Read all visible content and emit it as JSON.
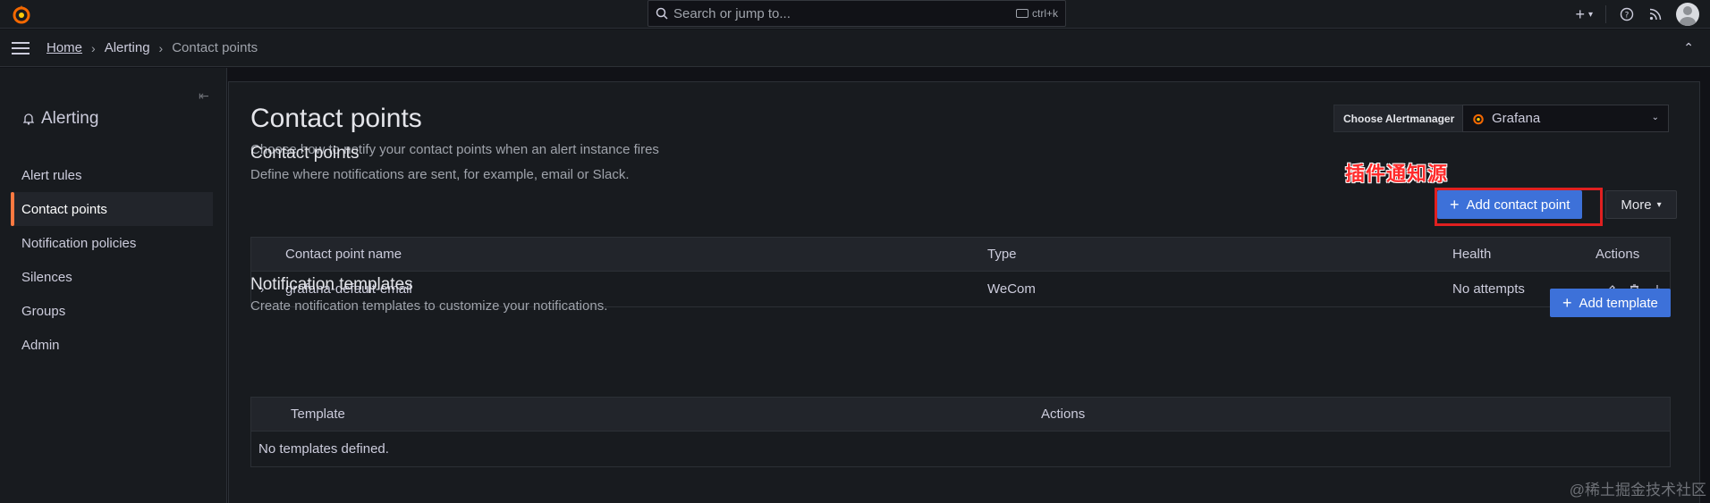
{
  "topbar": {
    "search_placeholder": "Search or jump to...",
    "search_shortcut": "ctrl+k",
    "icons": [
      "grafana-logo-icon",
      "search-icon",
      "keyboard-icon",
      "plus-icon",
      "help-icon",
      "rss-icon",
      "user-avatar"
    ]
  },
  "breadcrumb": {
    "home": "Home",
    "section": "Alerting",
    "current": "Contact points"
  },
  "sidebar": {
    "title": "Alerting",
    "items": [
      {
        "label": "Alert rules",
        "active": false
      },
      {
        "label": "Contact points",
        "active": true
      },
      {
        "label": "Notification policies",
        "active": false
      },
      {
        "label": "Silences",
        "active": false
      },
      {
        "label": "Groups",
        "active": false
      },
      {
        "label": "Admin",
        "active": false
      }
    ]
  },
  "page": {
    "title": "Contact points",
    "subtitle": "Choose how to notify your contact points when an alert instance fires",
    "alertmanager_label": "Choose Alertmanager",
    "alertmanager_value": "Grafana"
  },
  "contact_points": {
    "title": "Contact points",
    "subtitle": "Define where notifications are sent, for example, email or Slack.",
    "annotation": "插件通知源",
    "add_button": "Add contact point",
    "more_button": "More",
    "columns": [
      "Contact point name",
      "Type",
      "Health",
      "Actions"
    ],
    "rows": [
      {
        "name": "grafana-default-email",
        "type": "WeCom",
        "health": "No attempts"
      }
    ]
  },
  "templates": {
    "title": "Notification templates",
    "subtitle": "Create notification templates to customize your notifications.",
    "add_button": "Add template",
    "columns": [
      "Template",
      "Actions"
    ],
    "empty_text": "No templates defined."
  },
  "watermark": "@稀土掘金技术社区",
  "colors": {
    "background": "#111217",
    "panel": "#181b1f",
    "primary_button": "#3d71d9",
    "active_accent": "#ff7941",
    "annotation_red": "#e02020"
  }
}
